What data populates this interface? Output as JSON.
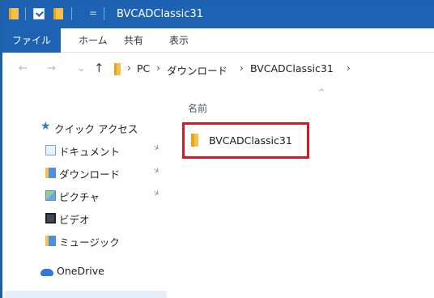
{
  "window": {
    "title": "BVCADClassic31",
    "title_separator": "="
  },
  "ribbon": {
    "tabs": [
      {
        "label": "ファイル",
        "active": true
      },
      {
        "label": "ホーム"
      },
      {
        "label": "共有"
      },
      {
        "label": "表示"
      }
    ]
  },
  "address": {
    "back": "←",
    "forward": "→",
    "recent": "⌄",
    "up": "↑",
    "crumbs": [
      "PC",
      "ダウンロード",
      "BVCADClassic31"
    ],
    "chevron": "›"
  },
  "content": {
    "column_header": "名前",
    "sort_indicator": "^",
    "items": [
      {
        "name": "BVCADClassic31",
        "icon": "folder-icon",
        "highlighted": true
      }
    ]
  },
  "navpane": {
    "items": [
      {
        "label": "クイック アクセス",
        "icon": "star-icon"
      },
      {
        "label": "ドキュメント",
        "icon": "documents-icon",
        "pinned": true
      },
      {
        "label": "ダウンロード",
        "icon": "downloads-icon",
        "pinned": true
      },
      {
        "label": "ピクチャ",
        "icon": "pictures-icon",
        "pinned": true
      },
      {
        "label": "ビデオ",
        "icon": "videos-icon"
      },
      {
        "label": "ミュージック",
        "icon": "music-icon"
      },
      {
        "label": "OneDrive",
        "icon": "onedrive-icon"
      }
    ],
    "pin_glyph": "✈"
  },
  "colors": {
    "titlebar": "#1e63b3",
    "highlight": "#e0141e",
    "folder": "#f2c14e"
  }
}
